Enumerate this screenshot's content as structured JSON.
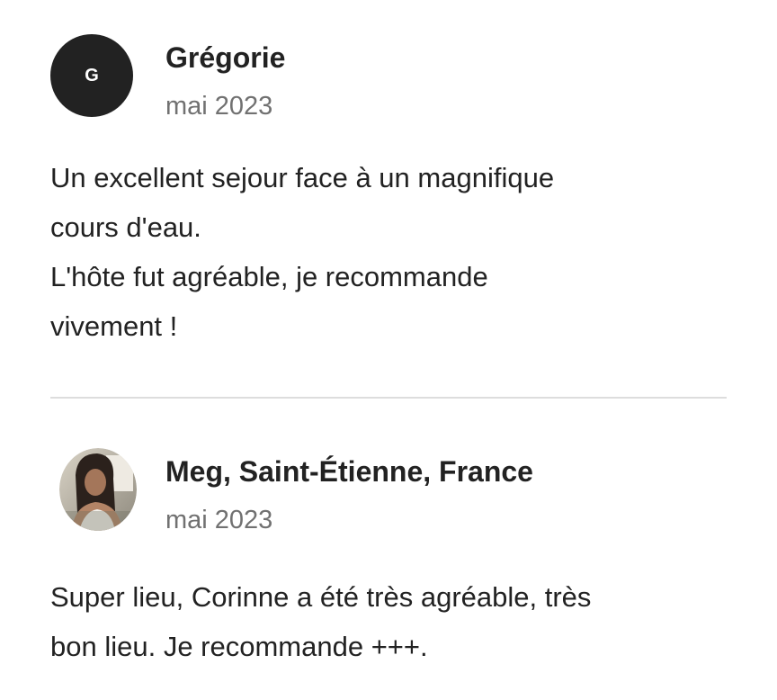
{
  "reviews": [
    {
      "avatar_initial": "G",
      "author": "Grégorie",
      "date": "mai 2023",
      "text": "Un excellent sejour face à un magnifique\ncours d'eau.\nL'hôte fut agréable,  je recommande\nvivement !"
    },
    {
      "avatar_icon": "profile-photo",
      "author": "Meg, Saint-Étienne, France",
      "date": "mai 2023",
      "text": "Super lieu, Corinne a été très agréable, très\nbon lieu. Je recommande +++."
    }
  ],
  "colors": {
    "text_primary": "#222222",
    "text_secondary": "#717171",
    "avatar_bg": "#222222",
    "divider": "#dddddd"
  }
}
